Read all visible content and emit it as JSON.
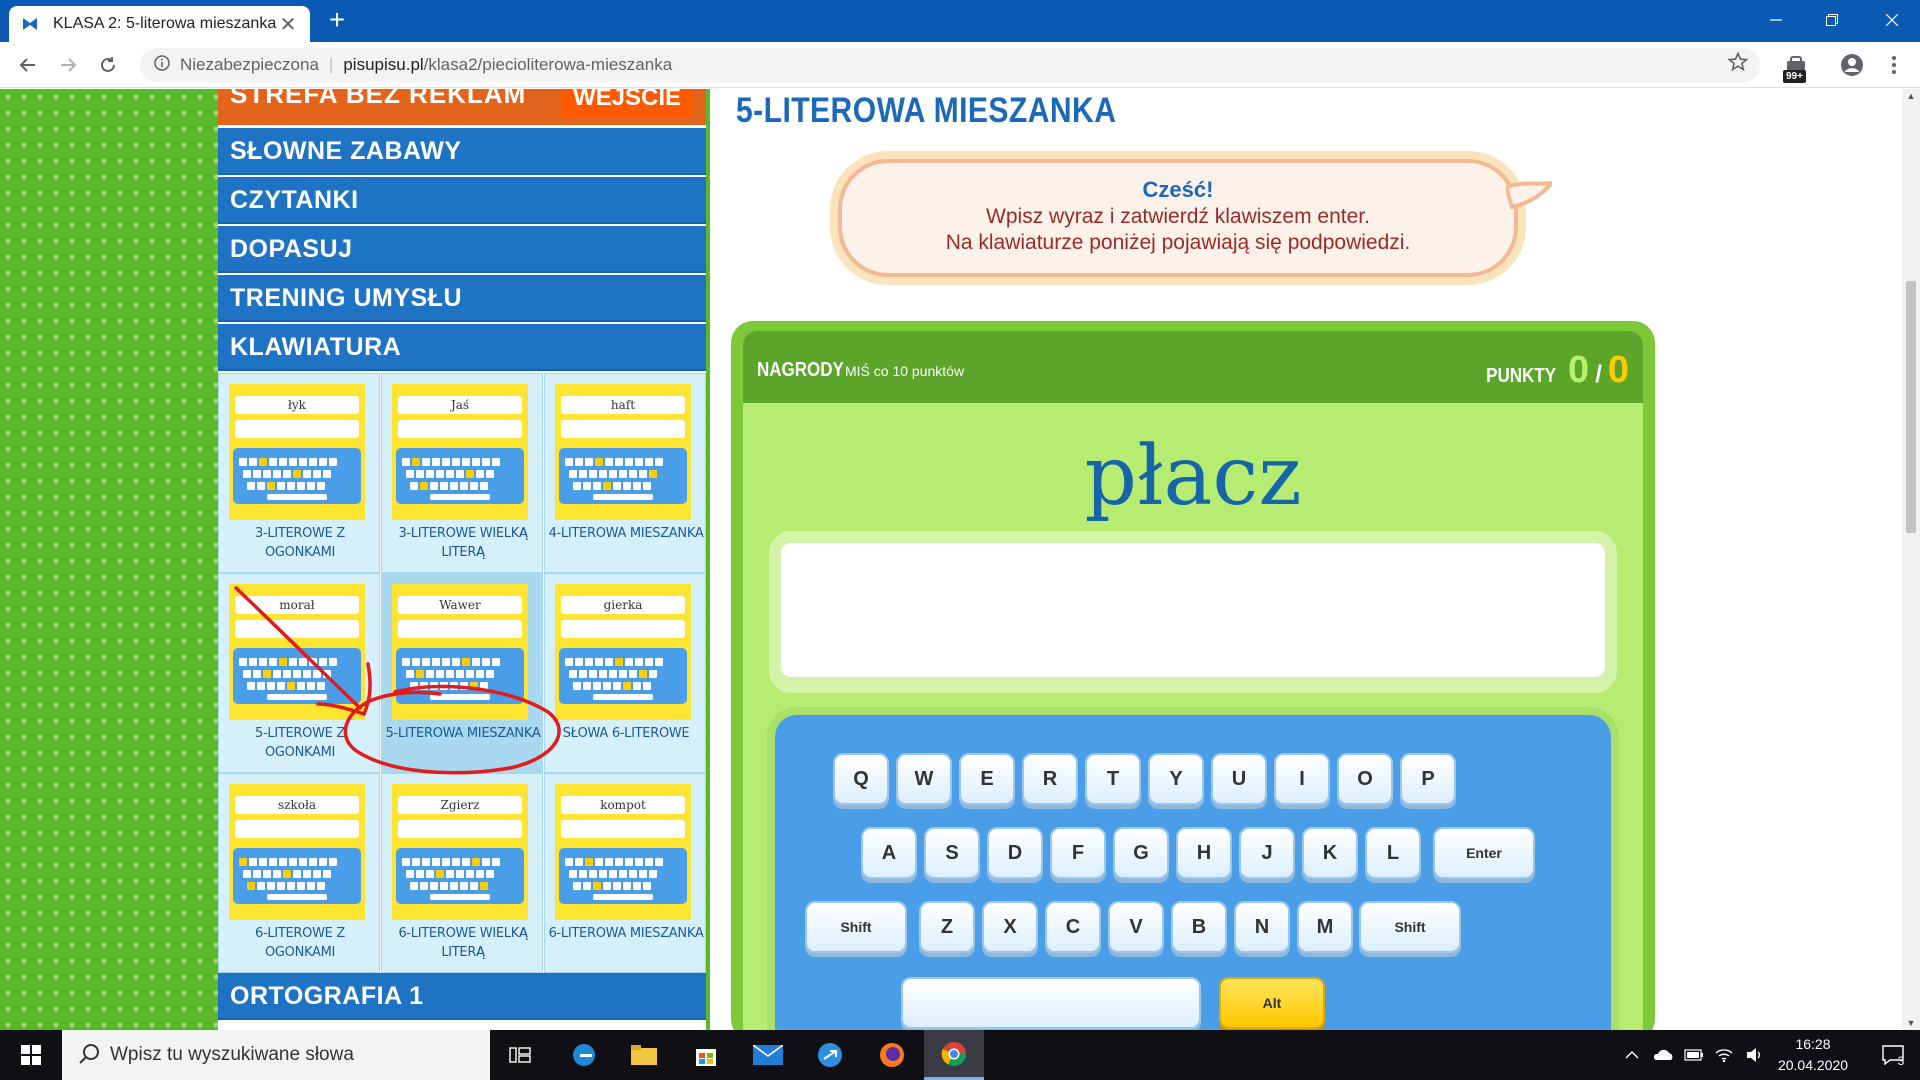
{
  "browser": {
    "tab_title": "KLASA 2: 5-literowa mieszanka",
    "close_glyph": "✕",
    "new_tab_glyph": "+",
    "security": "Niezabezpieczona",
    "separator": "|",
    "url_host": "pisupisu.pl",
    "url_path": "/klasa2/piecioliterowa-mieszanka",
    "extension_badge": "99+"
  },
  "sidebar": {
    "promo_text": "STREFA BEZ REKLAM",
    "promo_button": "WEJŚCIE",
    "items": [
      {
        "label": "SŁOWNE ZABAWY"
      },
      {
        "label": "CZYTANKI"
      },
      {
        "label": "DOPASUJ"
      },
      {
        "label": "TRENING UMYSŁU"
      },
      {
        "label": "KLAWIATURA"
      }
    ],
    "bottom_item": "ORTOGRAFIA 1",
    "games": [
      {
        "word": "łyk",
        "label": "3-LITEROWE Z OGONKAMI"
      },
      {
        "word": "Jaś",
        "label": "3-LITEROWE WIELKĄ LITERĄ"
      },
      {
        "word": "haft",
        "label": "4-LITEROWA MIESZANKA"
      },
      {
        "word": "morał",
        "label": "5-LITEROWE Z OGONKAMI"
      },
      {
        "word": "Wawer",
        "label": "5-LITEROWA MIESZANKA"
      },
      {
        "word": "gierka",
        "label": "SŁOWA 6-LITEROWE"
      },
      {
        "word": "szkoła",
        "label": "6-LITEROWE Z OGONKAMI"
      },
      {
        "word": "Zgierz",
        "label": "6-LITEROWE WIELKĄ LITERĄ"
      },
      {
        "word": "kompot",
        "label": "6-LITEROWA MIESZANKA"
      }
    ]
  },
  "main": {
    "page_title": "5-LITEROWA MIESZANKA",
    "bubble": {
      "greeting": "Cześć!",
      "line1": "Wpisz wyraz i zatwierdź klawiszem enter.",
      "line2": "Na klawiaturze poniżej pojawiają się podpowiedzi."
    },
    "rewards_label": "NAGRODY",
    "rewards_sub": "MIŚ co 10 punktów",
    "points_label": "PUNKTY",
    "points_current": "0",
    "points_slash": "/",
    "points_total": "0",
    "target_word": "płacz",
    "answer_value": ""
  },
  "keyboard": {
    "row1": [
      "Q",
      "W",
      "E",
      "R",
      "T",
      "Y",
      "U",
      "I",
      "O",
      "P"
    ],
    "row2": [
      "A",
      "S",
      "D",
      "F",
      "G",
      "H",
      "J",
      "K",
      "L",
      "Enter"
    ],
    "row3": [
      "Shift",
      "Z",
      "X",
      "C",
      "V",
      "B",
      "N",
      "M",
      "Shift"
    ],
    "alt": "Alt"
  },
  "taskbar": {
    "search_placeholder": "Wpisz tu wyszukiwane słowa",
    "time": "16:28",
    "date": "20.04.2020",
    "notifications": "3"
  },
  "colors": {
    "nav_blue": "#1f73c4",
    "title_blue": "#1c69b9",
    "promo_orange": "#e4641b",
    "annotation_red": "#e21b1b",
    "page_green": "#5bb82a"
  }
}
